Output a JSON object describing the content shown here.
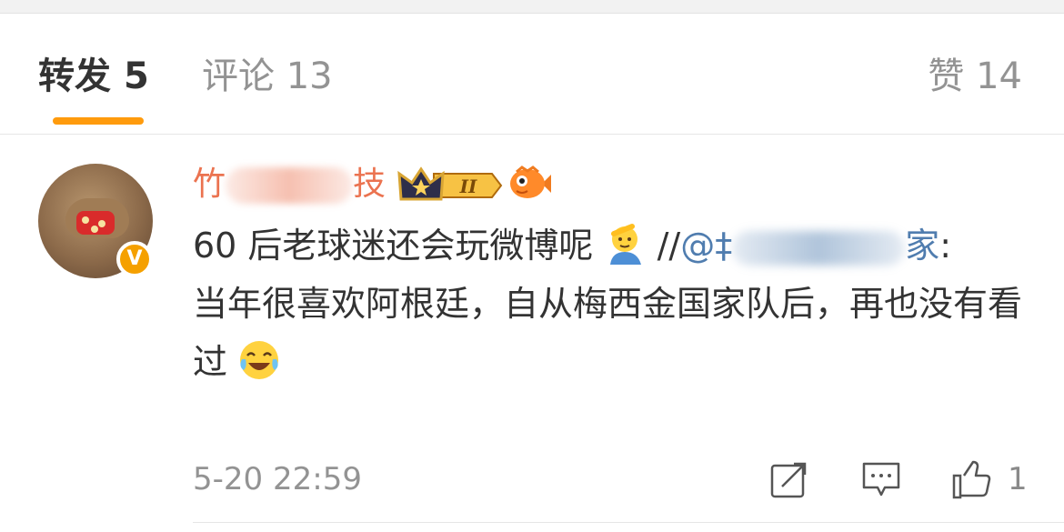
{
  "tabs": {
    "repost_label": "转发",
    "repost_count": "5",
    "comment_label": "评论",
    "comment_count": "13",
    "like_label": "赞",
    "like_count": "14"
  },
  "colors": {
    "accent": "#ff9b0d",
    "username": "#eb7350",
    "link": "#507daf",
    "muted": "#939393",
    "text": "#333333"
  },
  "comment": {
    "username_first": "竹",
    "username_last": "技",
    "level_badge": "II",
    "text_line1": "60 后老球迷还会玩微博呢",
    "repost_sep": " //",
    "mention_at": "@",
    "mention_first": "‡",
    "mention_last": "家",
    "colon": ":",
    "text_rest_a": "当年很喜欢阿根廷，自从梅西金国家队后，再也没有看过",
    "timestamp": "5-20 22:59",
    "like_count": "1"
  },
  "icons": [
    "crown-level-badge-icon",
    "fish-icon",
    "salute-emoji-icon",
    "laugh-cry-emoji-icon",
    "repost-icon",
    "comment-icon",
    "like-icon",
    "verified-v-icon"
  ]
}
